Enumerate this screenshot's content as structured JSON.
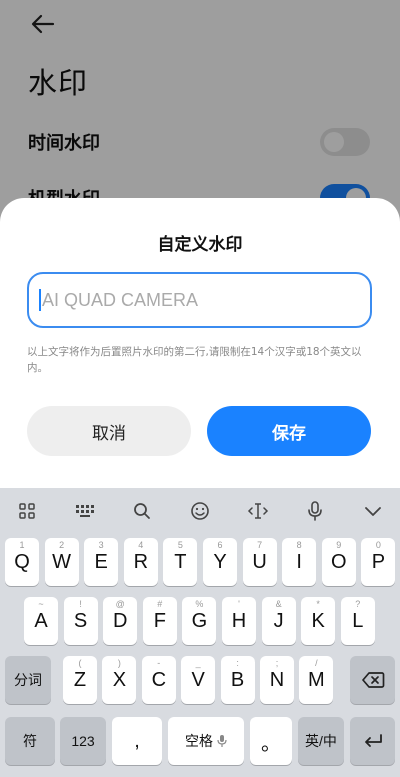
{
  "background_page": {
    "title": "水印",
    "settings": [
      {
        "label": "时间水印",
        "state": "off"
      },
      {
        "label": "机型水印",
        "state": "on"
      }
    ]
  },
  "dialog": {
    "title": "自定义水印",
    "input_placeholder": "AI QUAD CAMERA",
    "input_value": "",
    "hint": "以上文字将作为后置照片水印的第二行,请限制在14个汉字或18个英文以内。",
    "cancel_label": "取消",
    "save_label": "保存"
  },
  "colors": {
    "accent": "#1a82ff",
    "toggle_off": "#e4e4e4",
    "cancel_bg": "#eeeeee",
    "keyboard_bg": "#d8dbe0"
  },
  "keyboard": {
    "toolbar_icons": [
      "grid-icon",
      "keyboard-icon",
      "search-icon",
      "emoji-icon",
      "cursor-icon",
      "microphone-icon",
      "chevron-down-icon"
    ],
    "row1": [
      {
        "main": "Q",
        "sub": "1"
      },
      {
        "main": "W",
        "sub": "2"
      },
      {
        "main": "E",
        "sub": "3"
      },
      {
        "main": "R",
        "sub": "4"
      },
      {
        "main": "T",
        "sub": "5"
      },
      {
        "main": "Y",
        "sub": "6"
      },
      {
        "main": "U",
        "sub": "7"
      },
      {
        "main": "I",
        "sub": "8"
      },
      {
        "main": "O",
        "sub": "9"
      },
      {
        "main": "P",
        "sub": "0"
      }
    ],
    "row2": [
      {
        "main": "A",
        "sub": "~"
      },
      {
        "main": "S",
        "sub": "!"
      },
      {
        "main": "D",
        "sub": "@"
      },
      {
        "main": "F",
        "sub": "#"
      },
      {
        "main": "G",
        "sub": "%"
      },
      {
        "main": "H",
        "sub": "'"
      },
      {
        "main": "J",
        "sub": "&"
      },
      {
        "main": "K",
        "sub": "*"
      },
      {
        "main": "L",
        "sub": "?"
      }
    ],
    "row3": [
      {
        "main": "Z",
        "sub": "("
      },
      {
        "main": "X",
        "sub": ")"
      },
      {
        "main": "C",
        "sub": "-"
      },
      {
        "main": "V",
        "sub": "_"
      },
      {
        "main": "B",
        "sub": ":"
      },
      {
        "main": "N",
        "sub": ";"
      },
      {
        "main": "M",
        "sub": "/"
      }
    ],
    "fenci_label": "分词",
    "fu_label": "符",
    "num_label": "123",
    "comma_label": ",",
    "space_label": "空格",
    "period_label": "。",
    "lang_label": "英/中"
  }
}
